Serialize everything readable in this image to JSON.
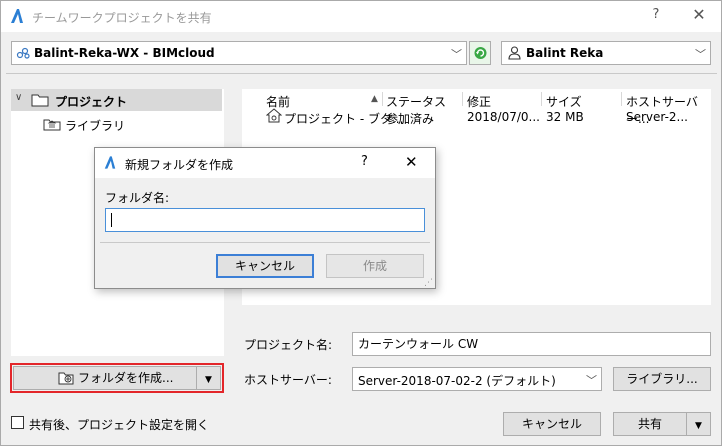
{
  "window": {
    "title": "チームワークプロジェクトを共有",
    "help_glyph": "?",
    "close_glyph": "✕"
  },
  "server_select": {
    "value": "Balint-Reka-WX - BIMcloud"
  },
  "user_select": {
    "value": "Balint Reka"
  },
  "tree": {
    "items": [
      {
        "label": "プロジェクト",
        "selected": true
      },
      {
        "label": "ライブラリ",
        "selected": false
      }
    ]
  },
  "list": {
    "headers": [
      "名前",
      "ステータス",
      "修正",
      "サイズ",
      "ホストサーバー..."
    ],
    "rows": [
      {
        "name": "プロジェクト - ブタ...",
        "status": "参加済み",
        "modified": "2018/07/0...",
        "size": "32 MB",
        "host": "Server-2..."
      }
    ]
  },
  "new_folder_dialog": {
    "title": "新規フォルダを作成",
    "help_glyph": "?",
    "close_glyph": "✕",
    "field_label": "フォルダ名:",
    "field_value": "",
    "cancel_label": "キャンセル",
    "create_label": "作成"
  },
  "create_folder_button": {
    "label": "フォルダを作成..."
  },
  "project_name": {
    "label": "プロジェクト名:",
    "value": "カーテンウォール CW"
  },
  "host_server": {
    "label": "ホストサーバー:",
    "value": "Server-2018-07-02-2 (デフォルト)"
  },
  "library_button": {
    "label": "ライブラリ..."
  },
  "open_settings": {
    "label": "共有後、プロジェクト設定を開く",
    "checked": false
  },
  "footer": {
    "cancel_label": "キャンセル",
    "share_label": "共有"
  }
}
